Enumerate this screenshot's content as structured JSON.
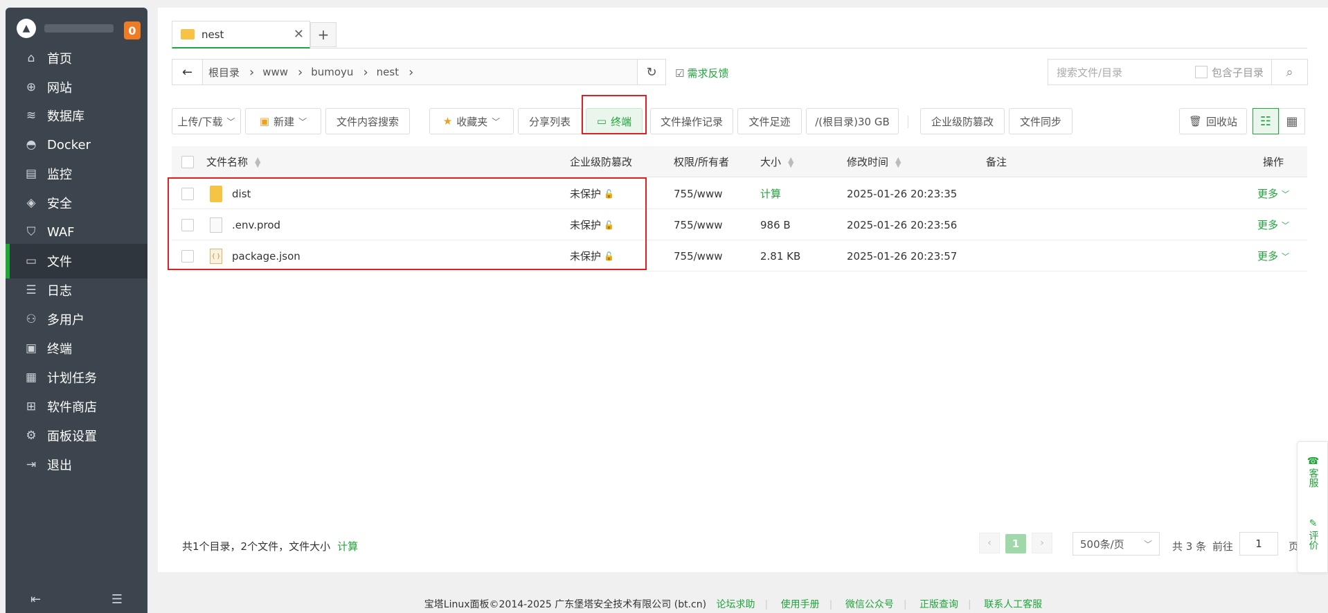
{
  "sidebar": {
    "badge": "0",
    "items": [
      {
        "label": "首页",
        "icon": "home-icon",
        "glyph": "⌂"
      },
      {
        "label": "网站",
        "icon": "globe-icon",
        "glyph": "⊕"
      },
      {
        "label": "数据库",
        "icon": "database-icon",
        "glyph": "≋"
      },
      {
        "label": "Docker",
        "icon": "docker-icon",
        "glyph": "◓"
      },
      {
        "label": "监控",
        "icon": "monitor-icon",
        "glyph": "▤"
      },
      {
        "label": "安全",
        "icon": "shield-icon",
        "glyph": "◈"
      },
      {
        "label": "WAF",
        "icon": "waf-icon",
        "glyph": "⛉"
      },
      {
        "label": "文件",
        "icon": "folder-icon",
        "glyph": "▭"
      },
      {
        "label": "日志",
        "icon": "log-icon",
        "glyph": "☰"
      },
      {
        "label": "多用户",
        "icon": "users-icon",
        "glyph": "⚇"
      },
      {
        "label": "终端",
        "icon": "terminal-icon",
        "glyph": "▣"
      },
      {
        "label": "计划任务",
        "icon": "calendar-icon",
        "glyph": "▦"
      },
      {
        "label": "软件商店",
        "icon": "store-icon",
        "glyph": "⊞"
      },
      {
        "label": "面板设置",
        "icon": "gear-icon",
        "glyph": "⚙"
      },
      {
        "label": "退出",
        "icon": "logout-icon",
        "glyph": "⇥"
      }
    ],
    "active_index": 7
  },
  "tabs": {
    "current": "nest",
    "close": "✕",
    "add": "+"
  },
  "path": {
    "back": "←",
    "crumbs": [
      "根目录",
      "www",
      "bumoyu",
      "nest"
    ],
    "refresh": "↻",
    "feedback": "需求反馈"
  },
  "search": {
    "placeholder": "搜索文件/目录",
    "include_sub": "包含子目录",
    "icon": "⌕"
  },
  "toolbar": {
    "upload": "上传/下载",
    "new": "新建",
    "content_search": "文件内容搜索",
    "favorites": "收藏夹",
    "share_list": "分享列表",
    "terminal": "终端",
    "op_log": "文件操作记录",
    "footprint": "文件足迹",
    "disk": "/(根目录)30 GB",
    "tamper": "企业级防篡改",
    "sync": "文件同步",
    "recycle": "回收站"
  },
  "table": {
    "headers": {
      "name": "文件名称",
      "tamper": "企业级防篡改",
      "perm": "权限/所有者",
      "size": "大小",
      "mtime": "修改时间",
      "note": "备注",
      "ops": "操作"
    },
    "rows": [
      {
        "type": "folder",
        "name": "dist",
        "tamper": "未保护",
        "perm": "755/www",
        "size": "计算",
        "mtime": "2025-01-26 20:23:35",
        "op": "更多"
      },
      {
        "type": "file",
        "name": ".env.prod",
        "tamper": "未保护",
        "perm": "755/www",
        "size": "986 B",
        "mtime": "2025-01-26 20:23:56",
        "op": "更多"
      },
      {
        "type": "json",
        "name": "package.json",
        "tamper": "未保护",
        "perm": "755/www",
        "size": "2.81 KB",
        "mtime": "2025-01-26 20:23:57",
        "op": "更多"
      }
    ]
  },
  "footer": {
    "stats": "共1个目录，2个文件，文件大小",
    "calc": "计算",
    "page": "1",
    "page_size": "500条/页",
    "total": "共 3 条",
    "goto": "前往",
    "goto_value": "1",
    "page_unit": "页"
  },
  "float": {
    "service": "客服",
    "rate": "评价"
  },
  "copyright": {
    "text": "宝塔Linux面板©2014-2025 广东堡塔安全技术有限公司 (bt.cn)",
    "links": [
      "论坛求助",
      "使用手册",
      "微信公众号",
      "正版查询",
      "联系人工客服"
    ]
  },
  "colors": {
    "accent": "#20a53a",
    "sidebar": "#3c444d",
    "badge": "#ef7b22",
    "highlight_box": "#e02020"
  }
}
